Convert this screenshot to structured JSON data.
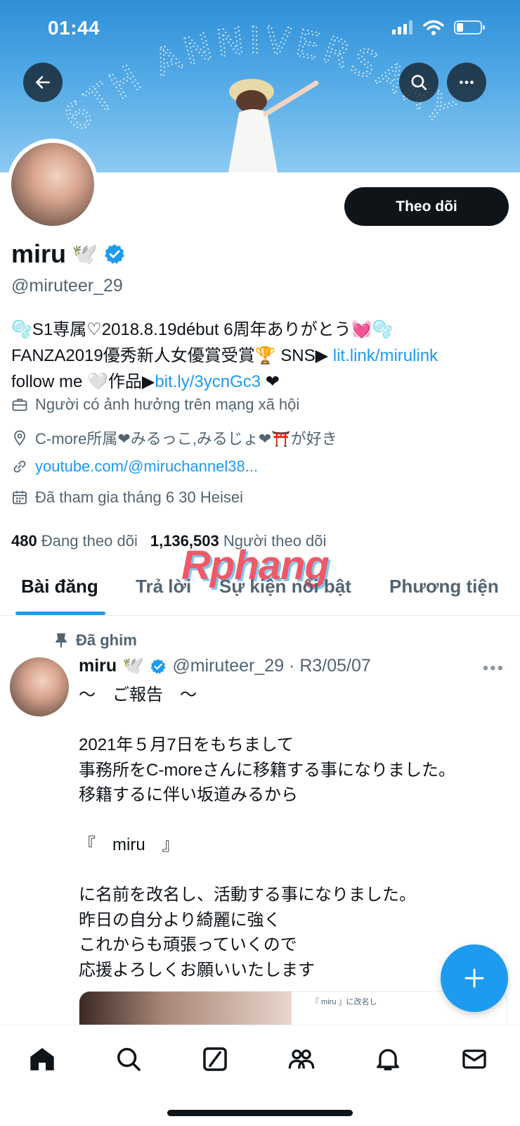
{
  "status_bar": {
    "time": "01:44"
  },
  "banner": {
    "text": "6TH ANNIVERSARY"
  },
  "header": {
    "back_icon": "arrow-left-icon",
    "search_icon": "search-icon",
    "more_icon": "more-horizontal-icon"
  },
  "profile": {
    "follow_label": "Theo dõi",
    "name": "miru",
    "name_emoji": "🕊️",
    "handle": "@miruteer_29",
    "bio": {
      "line1": "🫧S1専属♡2018.8.19début 6周年ありがとう💓🫧",
      "line2_text": "FANZA2019優秀新人女優賞受賞🏆 SNS▶ ",
      "line2_link": "lit.link/mirulink",
      "line3_text": "follow me 🤍作品▶",
      "line3_link": "bit.ly/3ycnGc3",
      "line3_end": " ❤"
    },
    "category": "Người có ảnh hưởng trên mạng xã hội",
    "location": "C-more所属❤みるっこ,みるじょ❤⛩️が好き",
    "website": "youtube.com/@miruchannel38...",
    "joined": "Đã tham gia tháng 6 30 Heisei",
    "following_count": "480",
    "following_label": "Đang theo dõi",
    "followers_count": "1,136,503",
    "followers_label": "Người theo dõi"
  },
  "watermark": "Rphang",
  "tabs": [
    {
      "label": "Bài đăng"
    },
    {
      "label": "Trả lời"
    },
    {
      "label": "Sự kiện nổi bật"
    },
    {
      "label": "Phương tiện"
    }
  ],
  "pinned_tweet": {
    "pinned_label": "Đã ghim",
    "name": "miru",
    "name_emoji": "🕊️",
    "meta": "@miruteer_29 · R3/05/07",
    "more": "•••",
    "body": "～　ご報告　～\n\n2021年５月7日をもちまして\n事務所をC-moreさんに移籍する事になりました。\n移籍するに伴い坂道みるから\n\n『　miru　』\n\nに名前を改名し、活動する事になりました。\n昨日の自分より綺麗に強く\nこれからも頑張っていくので\n応援よろしくお願いいたします",
    "media_caption": "『 miru 』に改名し"
  },
  "colors": {
    "accent": "#1d9bf0",
    "text": "#0f1419",
    "secondary": "#536471"
  },
  "bottom_nav": [
    "home-icon",
    "search-icon",
    "grok-icon",
    "communities-icon",
    "notifications-icon",
    "messages-icon"
  ]
}
